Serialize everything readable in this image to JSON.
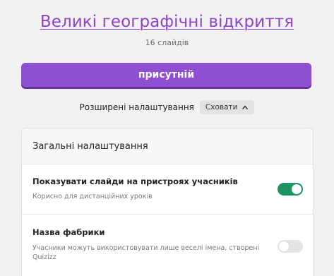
{
  "quiz": {
    "title": "Великі географічні відкриття",
    "slide_count": "16 слайдів"
  },
  "actions": {
    "present_label": "присутній"
  },
  "advanced": {
    "label": "Розширені налаштування",
    "hide_label": "Сховати",
    "hide_icon": "chevron-up-icon"
  },
  "general_settings": {
    "header": "Загальні налаштування",
    "items": [
      {
        "title": "Показувати слайди на пристроях учасників",
        "description": "Корисно для дистанційних уроків",
        "enabled": true
      },
      {
        "title": "Назва фабрики",
        "description": "Учасники можуть використовувати лише веселі імена, створені Quizizz",
        "enabled": false
      }
    ]
  },
  "colors": {
    "accent": "#8e4fd1",
    "title_link": "#8e44c9",
    "toggle_on": "#1d9361",
    "toggle_off": "#e4e4e4",
    "background": "#f2f2f2"
  }
}
